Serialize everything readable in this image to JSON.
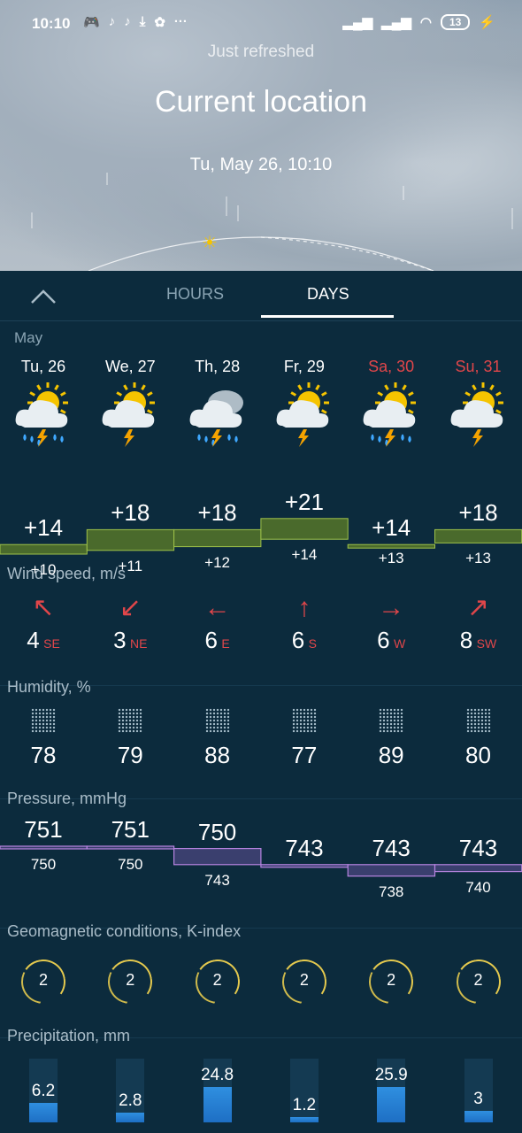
{
  "status": {
    "time": "10:10",
    "battery": "13",
    "left_icons": [
      "discord-icon",
      "tiktok-icon",
      "tiktok-icon",
      "download-icon",
      "gift-icon",
      "more-icon"
    ]
  },
  "header": {
    "refreshed": "Just refreshed",
    "location": "Current location",
    "date": "Tu, May 26, 10:10"
  },
  "tabs": {
    "hours": "HOURS",
    "days": "DAYS",
    "selected": "DAYS"
  },
  "month": "May",
  "days": [
    {
      "name": "Tu, 26",
      "weekend": false,
      "icon": "sun-cloud-rain-thunder-icon",
      "high": "+14",
      "low": "+10",
      "wind": "4",
      "wind_dir": "SE",
      "humidity": "78",
      "pressure_high": "751",
      "pressure_low": "750",
      "kindex": "2",
      "precip": "6.2",
      "precip_fill": 0.3
    },
    {
      "name": "We, 27",
      "weekend": false,
      "icon": "sun-cloud-thunder-icon",
      "high": "+18",
      "low": "+11",
      "wind": "3",
      "wind_dir": "NE",
      "humidity": "79",
      "pressure_high": "751",
      "pressure_low": "750",
      "kindex": "2",
      "precip": "2.8",
      "precip_fill": 0.15
    },
    {
      "name": "Th, 28",
      "weekend": false,
      "icon": "cloud-rain-thunder-icon",
      "high": "+18",
      "low": "+12",
      "wind": "6",
      "wind_dir": "E",
      "humidity": "88",
      "pressure_high": "750",
      "pressure_low": "743",
      "kindex": "2",
      "precip": "24.8",
      "precip_fill": 0.55
    },
    {
      "name": "Fr, 29",
      "weekend": false,
      "icon": "sun-cloud-thunder-icon",
      "high": "+21",
      "low": "+14",
      "wind": "6",
      "wind_dir": "S",
      "humidity": "77",
      "pressure_high": "743",
      "pressure_low": "",
      "kindex": "2",
      "precip": "1.2",
      "precip_fill": 0.08
    },
    {
      "name": "Sa, 30",
      "weekend": true,
      "icon": "sun-cloud-rain-thunder-icon",
      "high": "+14",
      "low": "+13",
      "wind": "6",
      "wind_dir": "W",
      "humidity": "89",
      "pressure_high": "743",
      "pressure_low": "738",
      "kindex": "2",
      "precip": "25.9",
      "precip_fill": 0.55
    },
    {
      "name": "Su, 31",
      "weekend": true,
      "icon": "sun-cloud-thunder-icon",
      "high": "+18",
      "low": "+13",
      "wind": "8",
      "wind_dir": "SW",
      "humidity": "80",
      "pressure_high": "743",
      "pressure_low": "740",
      "kindex": "2",
      "precip": "3",
      "precip_fill": 0.18
    }
  ],
  "sections": {
    "wind": "Wind speed, m/s",
    "humidity": "Humidity, %",
    "pressure": "Pressure, mmHg",
    "geo": "Geomagnetic conditions, K-index",
    "precip": "Precipitation, mm"
  },
  "colors": {
    "accent_weekend": "#e0464a",
    "temp_band": "#4a6a2c",
    "pressure_band": "#3a3f6e",
    "precip_fill": "#2f8fe0"
  }
}
